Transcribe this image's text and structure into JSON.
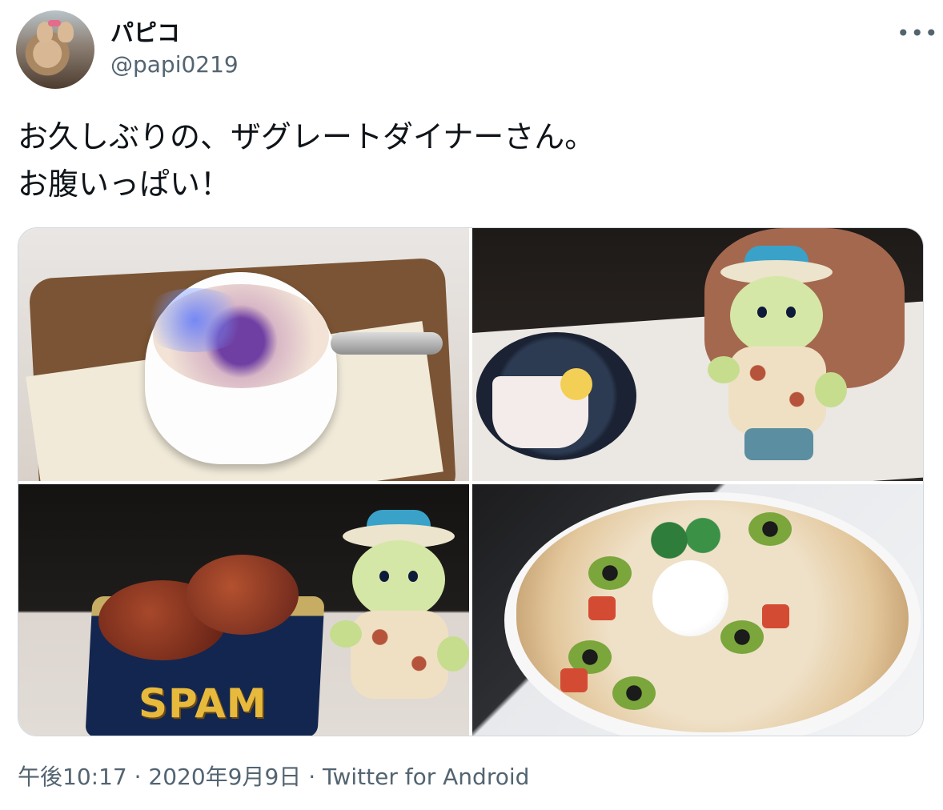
{
  "user": {
    "display_name": "パピコ",
    "handle": "@papi0219"
  },
  "menu": {
    "more_label": "•••"
  },
  "tweet": {
    "text_lines": [
      "お久しぶりの、ザグレートダイナーさん。",
      "お腹いっぱい！"
    ]
  },
  "media": {
    "photos": [
      {
        "id": "photo-1"
      },
      {
        "id": "photo-2"
      },
      {
        "id": "photo-3",
        "can_label": "SPAM"
      },
      {
        "id": "photo-4"
      }
    ]
  },
  "meta": {
    "time": "午後10:17",
    "separator": " · ",
    "date": "2020年9月9日",
    "source": "Twitter for Android"
  },
  "colors": {
    "text_primary": "#0f1419",
    "text_secondary": "#536471",
    "border": "#cfd9de"
  }
}
